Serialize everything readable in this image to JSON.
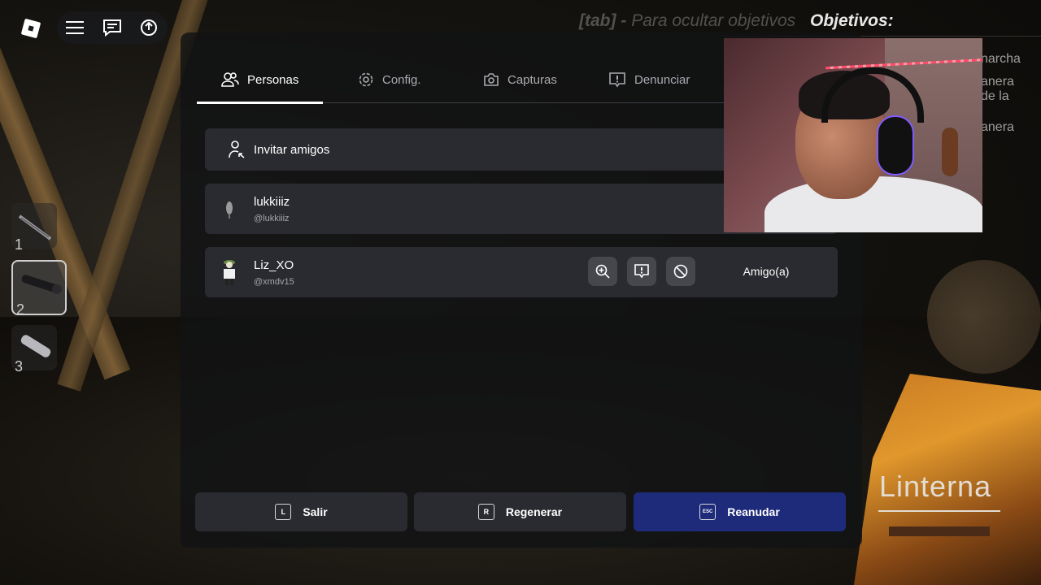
{
  "objectives": {
    "hint_key": "[tab]",
    "hint_dash": "-",
    "hint_text": "Para ocultar objetivos",
    "title": "Objetivos:",
    "items": [
      "narcha",
      "anera",
      "de la",
      "anera"
    ]
  },
  "topbar": {
    "menu_icon": "hamburger-menu-icon",
    "chat_icon": "chat-icon",
    "backpack_icon": "avatar-switch-icon"
  },
  "hotbar": {
    "slots": [
      {
        "num": "1",
        "item": "rifle"
      },
      {
        "num": "2",
        "item": "flashlight"
      },
      {
        "num": "3",
        "item": "flashlight-silver"
      }
    ],
    "active": "2"
  },
  "menu": {
    "tabs": [
      {
        "label": "Personas",
        "icon": "people-icon"
      },
      {
        "label": "Config.",
        "icon": "gear-icon"
      },
      {
        "label": "Capturas",
        "icon": "camera-icon"
      },
      {
        "label": "Denunciar",
        "icon": "report-icon"
      }
    ],
    "invite_label": "Invitar amigos",
    "players": [
      {
        "name": "lukkiiiz",
        "username": "@lukkiiiz"
      },
      {
        "name": "Liz_XO",
        "username": "@xmdv15",
        "status": "Amigo(a)"
      }
    ],
    "buttons": [
      {
        "key": "L",
        "label": "Salir"
      },
      {
        "key": "R",
        "label": "Regenerar"
      },
      {
        "key": "ESC",
        "label": "Reanudar"
      }
    ]
  },
  "tool": {
    "name": "Linterna"
  },
  "colors": {
    "primary_button": "#1e2b7a",
    "card": "#2a2b30"
  }
}
